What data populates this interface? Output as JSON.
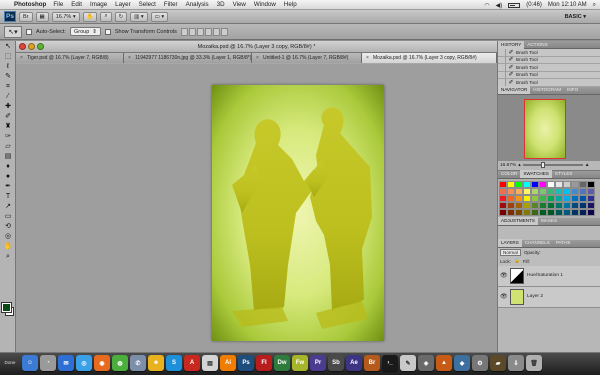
{
  "menubar": {
    "app_name": "Photoshop",
    "items": [
      "File",
      "Edit",
      "Image",
      "Layer",
      "Select",
      "Filter",
      "Analysis",
      "3D",
      "View",
      "Window",
      "Help"
    ],
    "battery": "(0:46)",
    "clock": "Mon 12:10 AM"
  },
  "appbar": {
    "logo": "Ps",
    "zoom": "16.7%",
    "workspace": "BASIC"
  },
  "options": {
    "auto_select_label": "Auto-Select:",
    "auto_select_value": "Group",
    "transform_label": "Show Transform Controls"
  },
  "document": {
    "title": "Mozaika.psd @ 16.7% (Layer 3 copy, RGB/8#) *",
    "tabs": [
      "Tiger.psd @ 16.7% (Layer 7, RGB/8)",
      "11942977 1186730n.jpg @ 33.3% (Layer 1, RGB/8*)",
      "Untitled-1 @ 16.7% (Layer 7, RGB/8#)",
      "Mozaika.psd @ 16.7% (Layer 3 copy, RGB/8#)"
    ]
  },
  "panels": {
    "history": {
      "tabs": [
        "HISTORY",
        "ACTIONS"
      ],
      "items": [
        "Brush Tool",
        "Brush Tool",
        "Brush Tool",
        "Brush Tool",
        "Brush Tool"
      ]
    },
    "navigator": {
      "tabs": [
        "NAVIGATOR",
        "HISTOGRAM",
        "INFO"
      ],
      "zoom": "16.67%"
    },
    "swatches": {
      "tabs": [
        "COLOR",
        "SWATCHES",
        "STYLES"
      ]
    },
    "adjustments": {
      "tabs": [
        "ADJUSTMENTS",
        "MASKS"
      ]
    },
    "layers": {
      "tabs": [
        "LAYERS",
        "CHANNELS",
        "PATHS"
      ],
      "blend_mode": "Normal",
      "opacity_label": "Opacity:",
      "lock_label": "Lock:",
      "fill_label": "Fill:",
      "items": [
        {
          "name": "Hue/Saturation 1",
          "kind": "adjustment"
        },
        {
          "name": "Layer 2",
          "kind": "pixel"
        }
      ]
    }
  },
  "dock": {
    "label": "Done",
    "apps": [
      "Ai",
      "Ps",
      "Fl",
      "Dw",
      "Fw",
      "Pr",
      "Sb",
      "Ae",
      "Br"
    ]
  }
}
